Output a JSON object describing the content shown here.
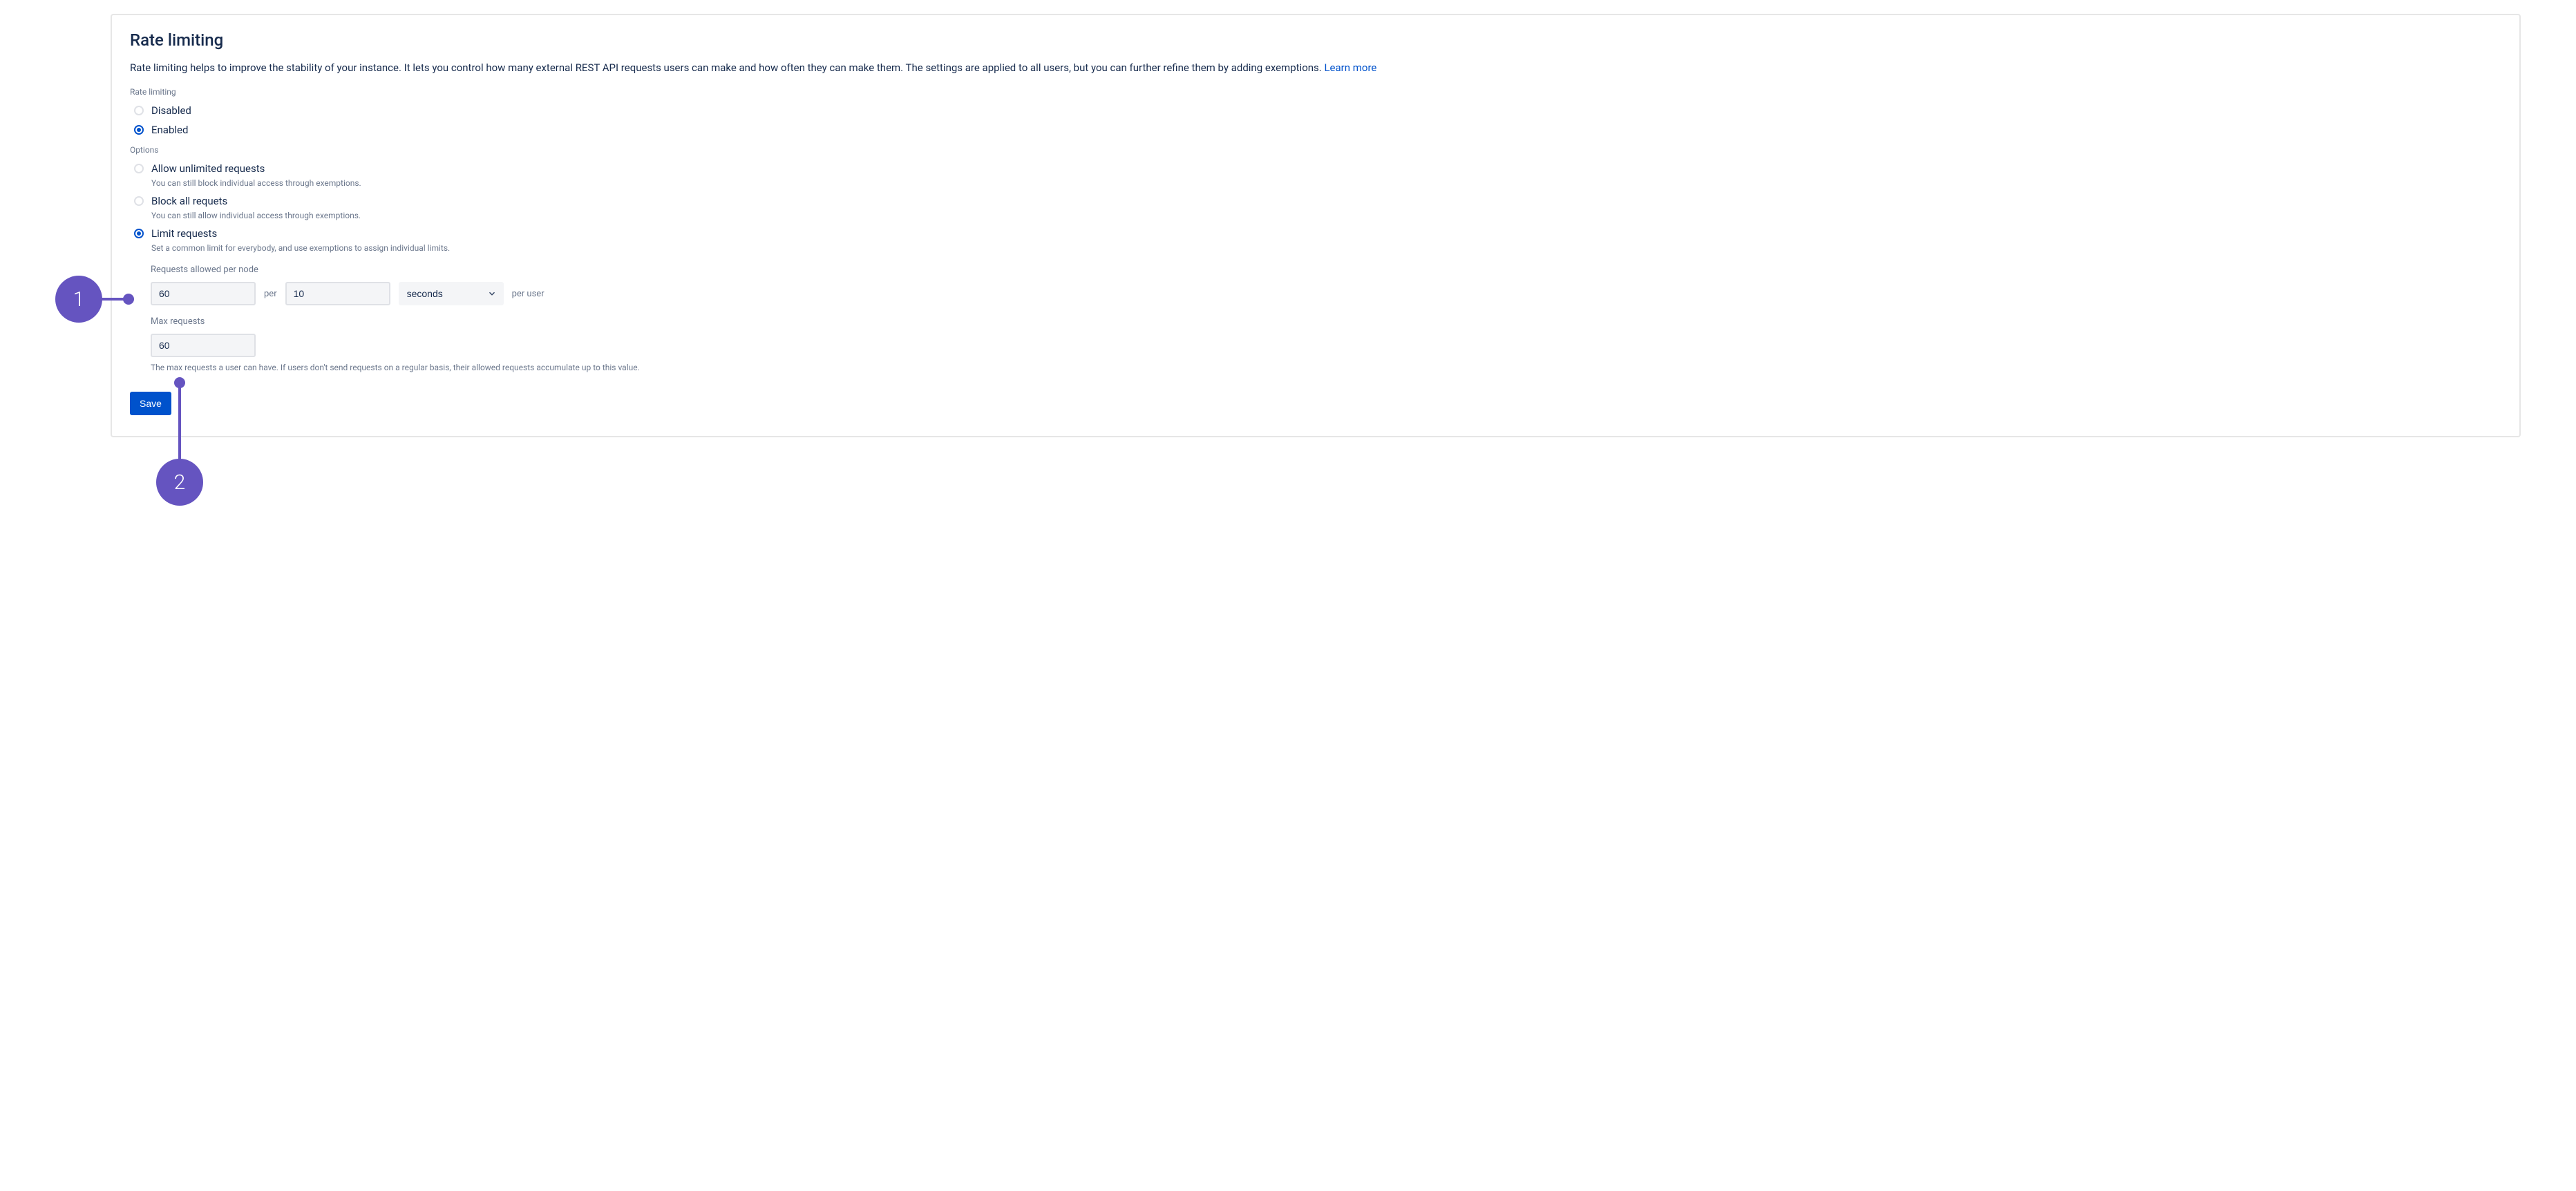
{
  "page": {
    "title": "Rate limiting",
    "description": "Rate limiting helps to improve the stability of your instance. It lets you control how many external REST API requests users can make and how often they can make them. The settings are applied to all users, but you can further refine them by adding exemptions. ",
    "learn_more": "Learn more"
  },
  "section_state": {
    "label": "Rate limiting",
    "disabled": "Disabled",
    "enabled": "Enabled"
  },
  "section_options": {
    "label": "Options",
    "allow": {
      "label": "Allow unlimited requests",
      "help": "You can still block individual access through exemptions."
    },
    "block": {
      "label": "Block all requets",
      "help": "You can still allow individual access through exemptions."
    },
    "limit": {
      "label": "Limit requests",
      "help": "Set a common limit for everybody, and use exemptions to assign individual limits."
    }
  },
  "limit_form": {
    "requests_label": "Requests allowed per node",
    "requests_value": "60",
    "per_text": "per",
    "interval_value": "10",
    "unit_value": "seconds",
    "per_user_text": "per user",
    "max_label": "Max requests",
    "max_value": "60",
    "max_help": "The max requests a user can have. If users don't send requests on a regular basis, their allowed requests accumulate up to this value."
  },
  "actions": {
    "save": "Save"
  },
  "annotations": {
    "one": "1",
    "two": "2"
  }
}
